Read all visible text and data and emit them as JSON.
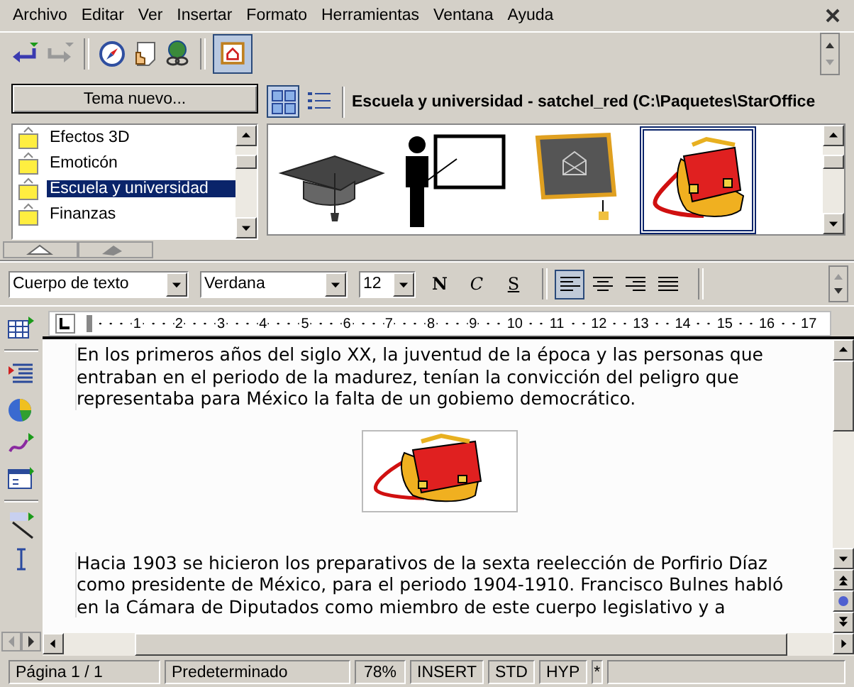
{
  "menu": [
    {
      "label": "Archivo"
    },
    {
      "label": "Editar"
    },
    {
      "label": "Ver"
    },
    {
      "label": "Insertar"
    },
    {
      "label": "Formato"
    },
    {
      "label": "Herramientas"
    },
    {
      "label": "Ventana"
    },
    {
      "label": "Ayuda"
    }
  ],
  "toolbar": {
    "gallery_toggle_selected": true
  },
  "gallery": {
    "new_theme_button": "Tema nuevo...",
    "title": "Escuela y universidad - satchel_red (C:\\Paquetes\\StarOffice",
    "view_modes": [
      {
        "kind": "icons",
        "selected": true
      },
      {
        "kind": "details",
        "selected": false
      }
    ],
    "themes": [
      {
        "label": "Efectos 3D",
        "selected": false
      },
      {
        "label": "Emoticón",
        "selected": false
      },
      {
        "label": "Escuela y universidad",
        "selected": true
      },
      {
        "label": "Finanzas",
        "selected": false
      }
    ],
    "items": [
      {
        "kind": "cap",
        "selected": false
      },
      {
        "kind": "teacher",
        "selected": false
      },
      {
        "kind": "chalkboard",
        "selected": false
      },
      {
        "kind": "satchel",
        "selected": true
      }
    ]
  },
  "formatting": {
    "paragraph_style": "Cuerpo de texto",
    "font": "Verdana",
    "size": "12",
    "style_buttons": [
      {
        "label": "N",
        "kind": "bold"
      },
      {
        "label": "C",
        "kind": "italic"
      },
      {
        "label": "S",
        "kind": "underline"
      }
    ],
    "alignment": [
      {
        "kind": "left",
        "selected": true
      },
      {
        "kind": "center",
        "selected": false
      },
      {
        "kind": "right",
        "selected": false
      },
      {
        "kind": "justify",
        "selected": false
      }
    ]
  },
  "ruler": {
    "ticks": [
      "1",
      "2",
      "3",
      "4",
      "5",
      "6",
      "7",
      "8",
      "9",
      "10",
      "11",
      "12",
      "13",
      "14",
      "15",
      "16",
      "17"
    ]
  },
  "document": {
    "blocks": [
      {
        "kind": "text",
        "text": "En los primeros años del siglo XX, la juventud de la época y las personas que entraban en el periodo de la madurez, tenían la convicción del peligro que representaba para México la falta de un gobiemo democrático."
      },
      {
        "kind": "image"
      },
      {
        "kind": "text",
        "text": "Hacia 1903 se hicieron los preparativos de la sexta reelección de Porfirio Díaz como presidente de México, para el periodo 1904-1910. Francisco Bulnes habló en la Cámara de Diputados como miembro de este cuerpo legislativo y a"
      }
    ]
  },
  "status_bar": {
    "page": "Página  1 / 1",
    "page_style": "Predeterminado",
    "zoom": "78%",
    "mode": "INSERT",
    "selection_mode": "STD",
    "hyperlink_mode": "HYP",
    "modified": "*"
  }
}
